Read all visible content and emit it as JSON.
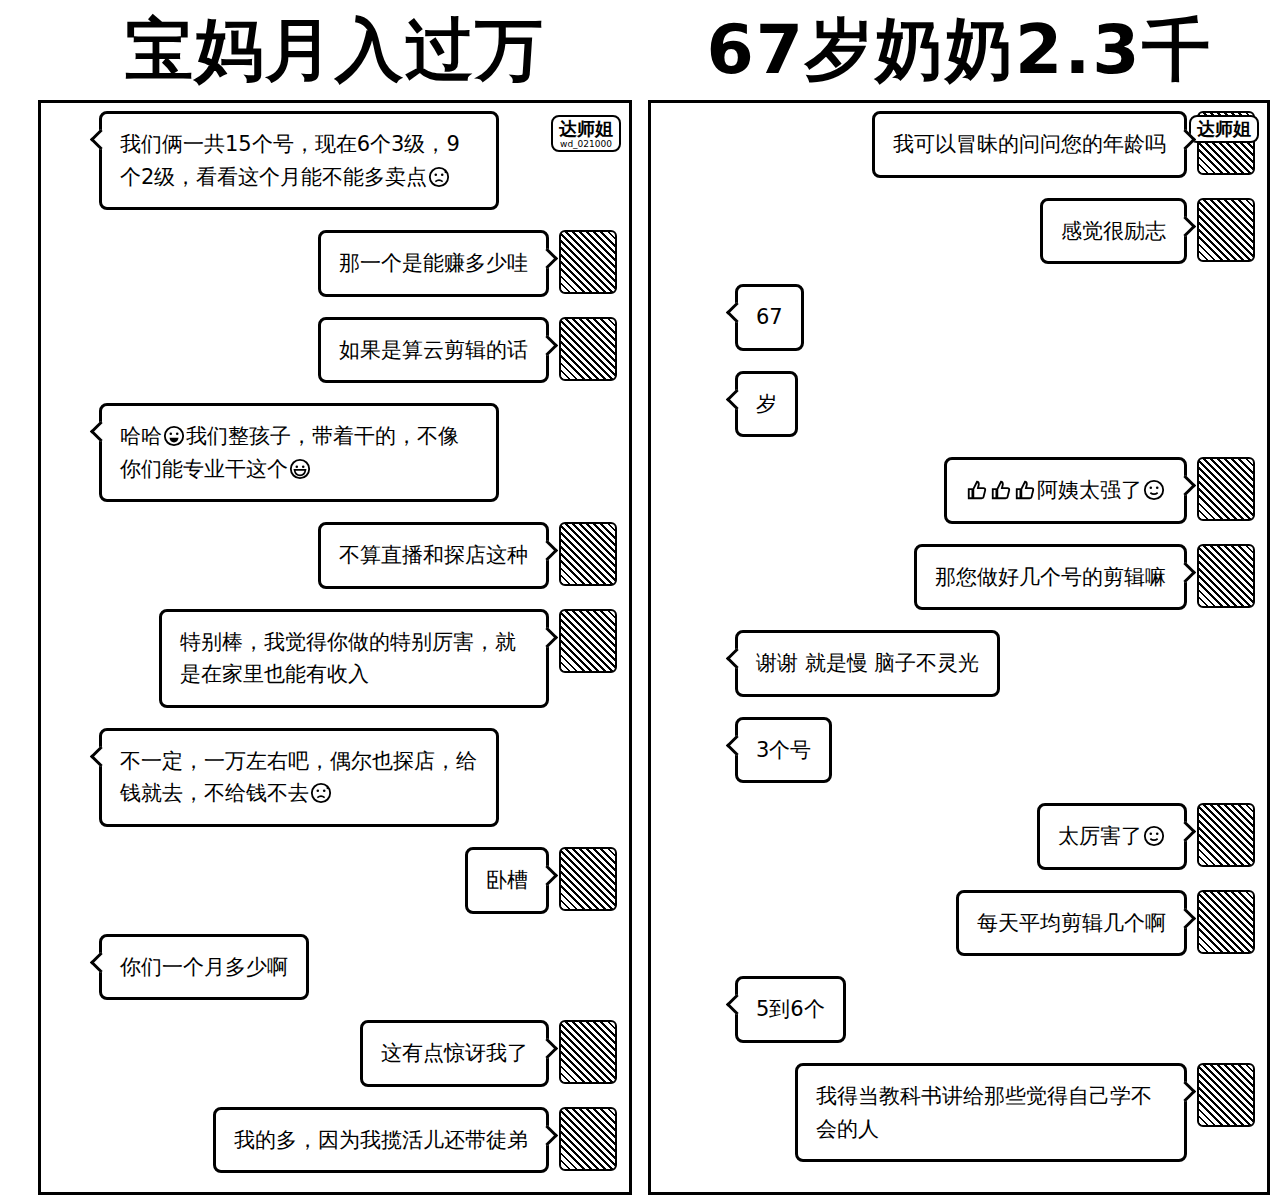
{
  "panels": [
    {
      "title": "宝妈月入过万",
      "badge": {
        "name": "达师姐",
        "id": "wd_021000"
      },
      "messages": [
        {
          "from": "other",
          "parts": [
            {
              "kind": "text",
              "text": "我们俩一共15个号，现在6个3级，9个2级，看看这个月能不能多卖点"
            },
            {
              "kind": "sweat"
            }
          ]
        },
        {
          "from": "self",
          "parts": [
            {
              "kind": "text",
              "text": "那一个是能赚多少哇"
            }
          ]
        },
        {
          "from": "self",
          "parts": [
            {
              "kind": "text",
              "text": "如果是算云剪辑的话"
            }
          ]
        },
        {
          "from": "other",
          "parts": [
            {
              "kind": "text",
              "text": "哈哈"
            },
            {
              "kind": "grin"
            },
            {
              "kind": "text",
              "text": "我们整孩子，带着干的，不像你们能专业干这个"
            },
            {
              "kind": "laugh"
            }
          ]
        },
        {
          "from": "self",
          "parts": [
            {
              "kind": "text",
              "text": "不算直播和探店这种"
            }
          ]
        },
        {
          "from": "self",
          "parts": [
            {
              "kind": "text",
              "text": "特别棒，我觉得你做的特别厉害，就是在家里也能有收入"
            }
          ]
        },
        {
          "from": "other",
          "parts": [
            {
              "kind": "text",
              "text": "不一定，一万左右吧，偶尔也探店，给钱就去，不给钱不去"
            },
            {
              "kind": "sweat"
            }
          ]
        },
        {
          "from": "self",
          "parts": [
            {
              "kind": "text",
              "text": "卧槽"
            }
          ]
        },
        {
          "from": "other",
          "parts": [
            {
              "kind": "text",
              "text": "你们一个月多少啊"
            }
          ]
        },
        {
          "from": "self",
          "parts": [
            {
              "kind": "text",
              "text": "这有点惊讶我了"
            }
          ]
        },
        {
          "from": "self",
          "parts": [
            {
              "kind": "text",
              "text": "我的多，因为我揽活儿还带徒弟"
            }
          ]
        }
      ]
    },
    {
      "title": "67岁奶奶2.3千",
      "badge": {
        "name": "达师姐"
      },
      "messages": [
        {
          "from": "self",
          "parts": [
            {
              "kind": "text",
              "text": "我可以冒昧的问问您的年龄吗"
            }
          ]
        },
        {
          "from": "self",
          "parts": [
            {
              "kind": "text",
              "text": "感觉很励志"
            }
          ]
        },
        {
          "from": "other",
          "parts": [
            {
              "kind": "text",
              "text": "67"
            }
          ]
        },
        {
          "from": "other",
          "parts": [
            {
              "kind": "text",
              "text": "岁"
            }
          ]
        },
        {
          "from": "self",
          "parts": [
            {
              "kind": "thumbs"
            },
            {
              "kind": "thumbs"
            },
            {
              "kind": "thumbs"
            },
            {
              "kind": "text",
              "text": "阿姨太强了"
            },
            {
              "kind": "blush"
            }
          ]
        },
        {
          "from": "self",
          "parts": [
            {
              "kind": "text",
              "text": "那您做好几个号的剪辑嘛"
            }
          ]
        },
        {
          "from": "other",
          "parts": [
            {
              "kind": "text",
              "text": "谢谢 就是慢 脑子不灵光"
            }
          ]
        },
        {
          "from": "other",
          "parts": [
            {
              "kind": "text",
              "text": "3个号"
            }
          ]
        },
        {
          "from": "self",
          "parts": [
            {
              "kind": "text",
              "text": "太厉害了"
            },
            {
              "kind": "blush"
            }
          ]
        },
        {
          "from": "self",
          "parts": [
            {
              "kind": "text",
              "text": "每天平均剪辑几个啊"
            }
          ]
        },
        {
          "from": "other",
          "parts": [
            {
              "kind": "text",
              "text": "5到6个"
            }
          ]
        },
        {
          "from": "self",
          "parts": [
            {
              "kind": "text",
              "text": "我得当教科书讲给那些觉得自己学不会的人"
            }
          ]
        }
      ]
    }
  ]
}
